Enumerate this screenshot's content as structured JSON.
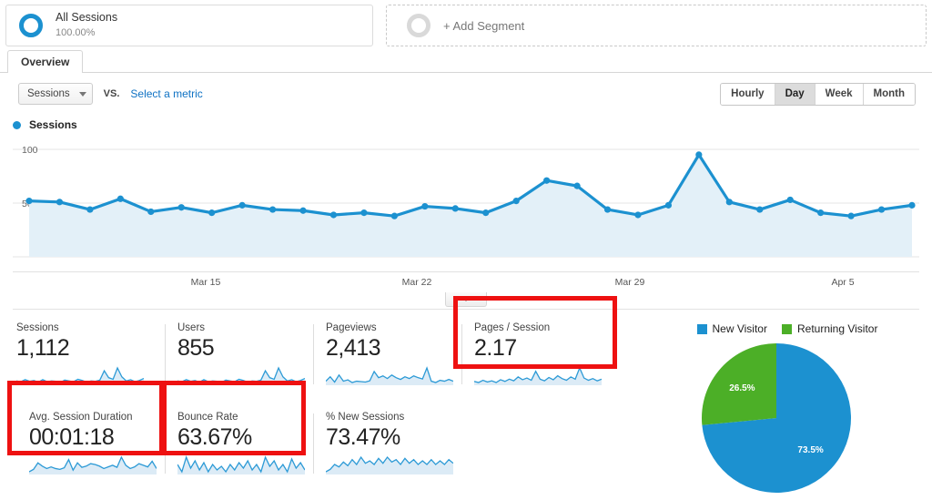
{
  "segment_bar": {
    "applied_segment": {
      "name": "All Sessions",
      "percent": "100.00%",
      "icon": "ring-icon"
    },
    "add_segment": {
      "label": "+ Add Segment",
      "icon": "ring-empty-icon"
    }
  },
  "tabs": [
    {
      "label": "Overview",
      "active": true
    }
  ],
  "controls": {
    "primary_metric": "Sessions",
    "vs_label": "VS.",
    "secondary_metric_link": "Select a metric",
    "granularity": [
      {
        "label": "Hourly",
        "active": false
      },
      {
        "label": "Day",
        "active": true
      },
      {
        "label": "Week",
        "active": false
      },
      {
        "label": "Month",
        "active": false
      }
    ]
  },
  "chart_data": {
    "type": "line",
    "title": "",
    "legend": [
      "Sessions"
    ],
    "legend_position": "top-left",
    "xlabel": "",
    "ylabel": "",
    "ylim": [
      0,
      100
    ],
    "yticks": [
      "50",
      "100"
    ],
    "grid": true,
    "xticks": [
      "Mar 15",
      "Mar 22",
      "Mar 29",
      "Apr 5"
    ],
    "series": [
      {
        "name": "Sessions",
        "color": "#1c91d0",
        "values": [
          52,
          51,
          44,
          54,
          42,
          46,
          41,
          48,
          44,
          43,
          39,
          41,
          38,
          47,
          45,
          41,
          52,
          71,
          66,
          44,
          39,
          48,
          95,
          51,
          44,
          53,
          41,
          38,
          44,
          48
        ]
      }
    ]
  },
  "pie_chart": {
    "type": "pie",
    "title": "",
    "legend_position": "top",
    "slices": [
      {
        "label": "New Visitor",
        "value": 73.5,
        "display": "73.5%",
        "color": "#1c91d0"
      },
      {
        "label": "Returning Visitor",
        "value": 26.5,
        "display": "26.5%",
        "color": "#4caf27"
      }
    ]
  },
  "metric_cards": [
    {
      "label": "Sessions",
      "value": "1,112",
      "highlighted": false,
      "sparkline": [
        30,
        28,
        33,
        29,
        31,
        27,
        33,
        28,
        30,
        29,
        26,
        32,
        30,
        28,
        34,
        31,
        27,
        30,
        29,
        32,
        55,
        38,
        34,
        62,
        40,
        30,
        33,
        28,
        31,
        36
      ]
    },
    {
      "label": "Users",
      "value": "855",
      "highlighted": false,
      "sparkline": [
        29,
        27,
        32,
        28,
        30,
        26,
        32,
        27,
        29,
        28,
        25,
        31,
        29,
        27,
        33,
        30,
        26,
        29,
        28,
        31,
        54,
        37,
        33,
        61,
        39,
        29,
        32,
        27,
        30,
        35
      ]
    },
    {
      "label": "Pageviews",
      "value": "2,413",
      "highlighted": false,
      "sparkline": [
        30,
        40,
        28,
        44,
        30,
        33,
        27,
        30,
        29,
        28,
        31,
        52,
        38,
        42,
        36,
        44,
        38,
        34,
        40,
        36,
        42,
        38,
        35,
        60,
        30,
        27,
        32,
        30,
        34,
        30
      ]
    },
    {
      "label": "Pages / Session",
      "value": "2.17",
      "highlighted": true,
      "sparkline": [
        26,
        24,
        28,
        25,
        27,
        24,
        29,
        26,
        30,
        27,
        34,
        29,
        32,
        28,
        44,
        30,
        27,
        33,
        29,
        36,
        31,
        28,
        34,
        30,
        50,
        32,
        28,
        31,
        27,
        30
      ]
    },
    {
      "label": "Avg. Session Duration",
      "value": "00:01:18",
      "highlighted": true,
      "sparkline": [
        22,
        28,
        44,
        36,
        30,
        34,
        30,
        28,
        32,
        52,
        26,
        44,
        33,
        36,
        42,
        40,
        36,
        30,
        34,
        38,
        33,
        58,
        38,
        30,
        34,
        42,
        38,
        34,
        48,
        30
      ]
    },
    {
      "label": "Bounce Rate",
      "value": "63.67%",
      "highlighted": true,
      "sparkline": [
        34,
        30,
        38,
        32,
        36,
        31,
        35,
        30,
        34,
        31,
        33,
        30,
        34,
        31,
        35,
        32,
        36,
        31,
        34,
        30,
        38,
        33,
        36,
        31,
        34,
        30,
        37,
        32,
        35,
        31
      ]
    },
    {
      "label": "% New Sessions",
      "value": "73.47%",
      "highlighted": false,
      "sparkline": [
        24,
        26,
        30,
        28,
        32,
        29,
        34,
        30,
        36,
        31,
        33,
        30,
        35,
        31,
        36,
        32,
        34,
        30,
        35,
        31,
        34,
        30,
        33,
        30,
        34,
        30,
        33,
        30,
        34,
        31
      ]
    }
  ]
}
